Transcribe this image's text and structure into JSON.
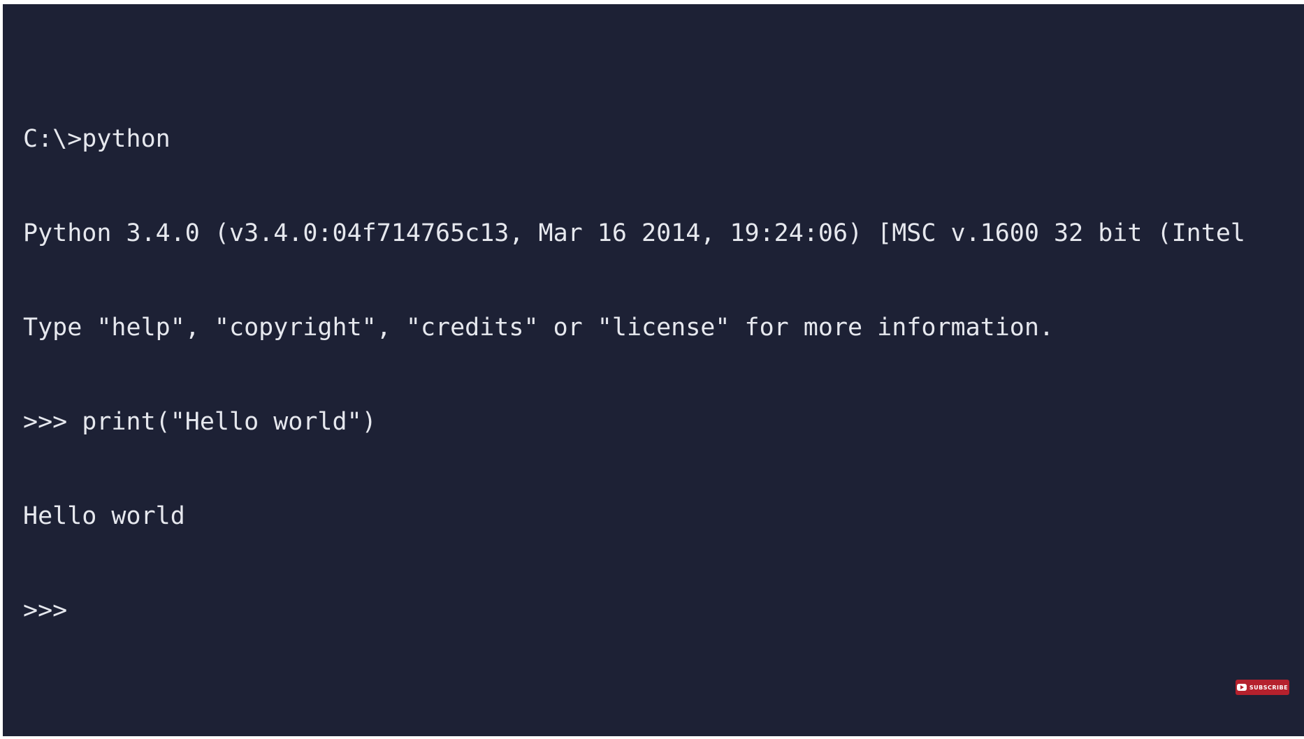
{
  "console": {
    "lines": [
      "C:\\>python",
      "Python 3.4.0 (v3.4.0:04f714765c13, Mar 16 2014, 19:24:06) [MSC v.1600 32 bit (Intel",
      "Type \"help\", \"copyright\", \"credits\" or \"license\" for more information.",
      ">>> print(\"Hello world\")",
      "Hello world",
      ">>> "
    ]
  },
  "subscribe": {
    "label": "SUBSCRIBE",
    "icon": "youtube-play-icon",
    "color": "#b5212d"
  },
  "colors": {
    "background": "#1d2135",
    "text": "#e6e8ee"
  }
}
